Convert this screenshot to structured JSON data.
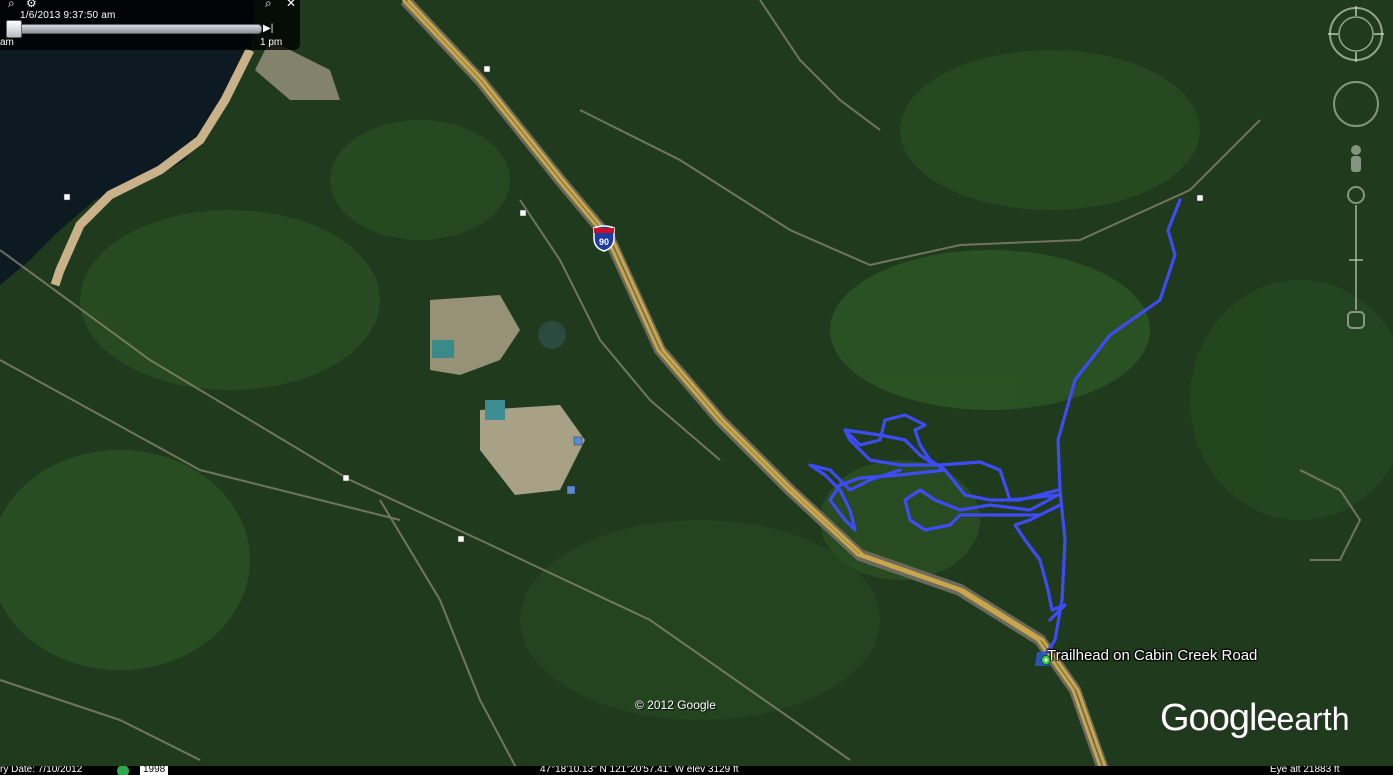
{
  "timeslider": {
    "date_time": "1/6/2013   9:37:50 am",
    "start_label": "am",
    "end_label": "1 pm",
    "position": 0.02,
    "zoom_icon": "zoom-icon",
    "settings_icon": "settings-icon",
    "close_icon": "close-icon",
    "next_icon": "skip-forward-icon"
  },
  "placemark": {
    "label": "Trailhead on Cabin Creek Road",
    "icon": "trailhead-pin-icon"
  },
  "highway_shield": "90",
  "copyright": "© 2012 Google",
  "logo": {
    "google": "Google",
    "earth": "earth"
  },
  "status_bar": {
    "imagery_date": "ry Date: 7/10/2012",
    "year": "1998",
    "coordinates": "47°18'10.13\" N  121°20'57.41\" W  elev  3129 ft",
    "eye_alt": "Eye alt    21883 ft"
  },
  "colors": {
    "track": "#3d4cf5",
    "forest": "#1f3a1c",
    "highway": "#c9a64a",
    "water": "#0d1a22"
  }
}
